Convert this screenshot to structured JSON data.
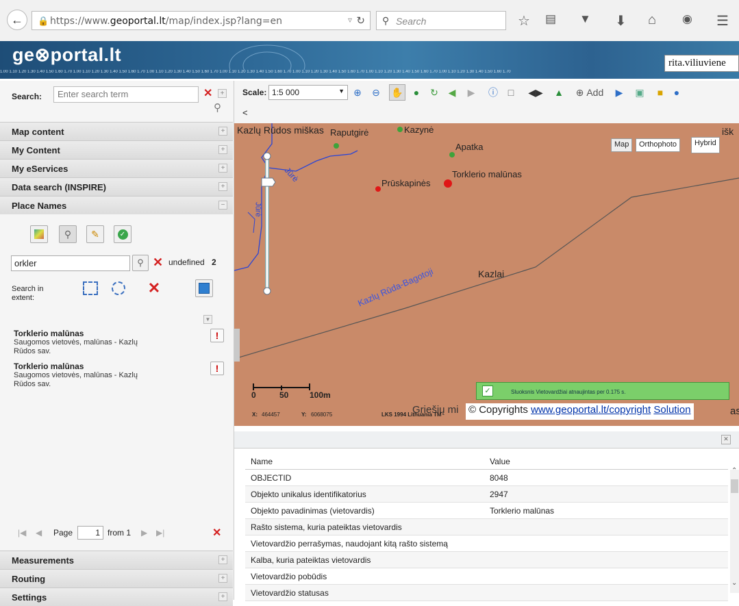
{
  "browser": {
    "url_prefix": "https://www.",
    "url_domain": "geoportal.lt",
    "url_path": "/map/index.jsp?lang=en",
    "search_placeholder": "Search"
  },
  "banner": {
    "logo": "ge⊗portal.lt",
    "user": "rita.viliuviene",
    "ruler_text": "1.00 1.10 1.20 1.30 1.40 1.50 1.60 1.70 1.00 1.10 1.20 1.30 1.40 1.50 1.60 1.70 1.00 1.10 1.20 1.30 1.40 1.50 1.60 1.70 1.00 1.10 1.20 1.30 1.40 1.50 1.60 1.70 1.00 1.10 1.20 1.30 1.40 1.50 1.60 1.70 1.00 1.10 1.20 1.30 1.40 1.50 1.60 1.70 1.00 1.10 1.20 1.30 1.40 1.50 1.60 1.70"
  },
  "left": {
    "search_label": "Search:",
    "search_placeholder": "Enter search term",
    "sections_top": [
      "Map content",
      "My Content",
      "My eServices",
      "Data search (INSPIRE)",
      "Place Names"
    ],
    "place_input": "orkler",
    "undefined_label": "undefined",
    "undefined_count": "2",
    "search_in_extent": "Search in extent:",
    "results": [
      {
        "title": "Torklerio malūnas",
        "sub1": "Saugomos vietovės, malūnas - Kazlų",
        "sub2": "Rūdos sav."
      },
      {
        "title": "Torklerio malūnas",
        "sub1": "Saugomos vietovės, malūnas - Kazlų",
        "sub2": "Rūdos sav."
      }
    ],
    "pager": {
      "page_label": "Page",
      "page_value": "1",
      "from_label": "from 1"
    },
    "sections_bottom": [
      "Measurements",
      "Routing",
      "Settings"
    ]
  },
  "toolbar": {
    "scale_label": "Scale:",
    "scale_value": "1:5 000",
    "add_label": "Add"
  },
  "map": {
    "labels": {
      "kazlu_rudos": "Kazlų Rūdos miškas",
      "raputgire": "Raputgirė",
      "kazyne": "Kazynė",
      "apatka": "Apatka",
      "pruskapines": "Prūskapinės",
      "torklerio": "Torklerio malūnas",
      "jure1": "Jūrė",
      "jure2": "Jūrė",
      "kazlai": "Kazlai",
      "road": "Kazlų Rūda-Bagotoji",
      "griesiu": "Griešių mi",
      "cut_top": "išk",
      "cut_bottom": "as"
    },
    "layers": [
      "Map",
      "Orthophoto",
      "Hybrid"
    ],
    "scalebar": {
      "t0": "0",
      "t50": "50",
      "t100": "100m"
    },
    "coords": {
      "x_label": "X:",
      "x": "464457",
      "y_label": "Y:",
      "y": "6068075",
      "crs": "LKS 1994 Lithuania TM"
    },
    "notification": "Sluoksnis Vietovardžiai atnaujintas per 0.175 s.",
    "copyright_prefix": "© Copyrights",
    "copyright_link": "www.geoportal.lt/copyright",
    "copyright_solution": "Solution"
  },
  "attributes": {
    "headers": [
      "Name",
      "Value"
    ],
    "rows": [
      [
        "OBJECTID",
        "8048"
      ],
      [
        "Objekto unikalus identifikatorius",
        "2947"
      ],
      [
        "Objekto pavadinimas (vietovardis)",
        "Torklerio malūnas"
      ],
      [
        "Rašto sistema, kuria pateiktas vietovardis",
        ""
      ],
      [
        "Vietovardžio perrašymas, naudojant kitą rašto sistemą",
        ""
      ],
      [
        "Kalba, kuria pateiktas vietovardis",
        ""
      ],
      [
        "Vietovardžio pobūdis",
        ""
      ],
      [
        "Vietovardžio statusas",
        ""
      ]
    ]
  }
}
